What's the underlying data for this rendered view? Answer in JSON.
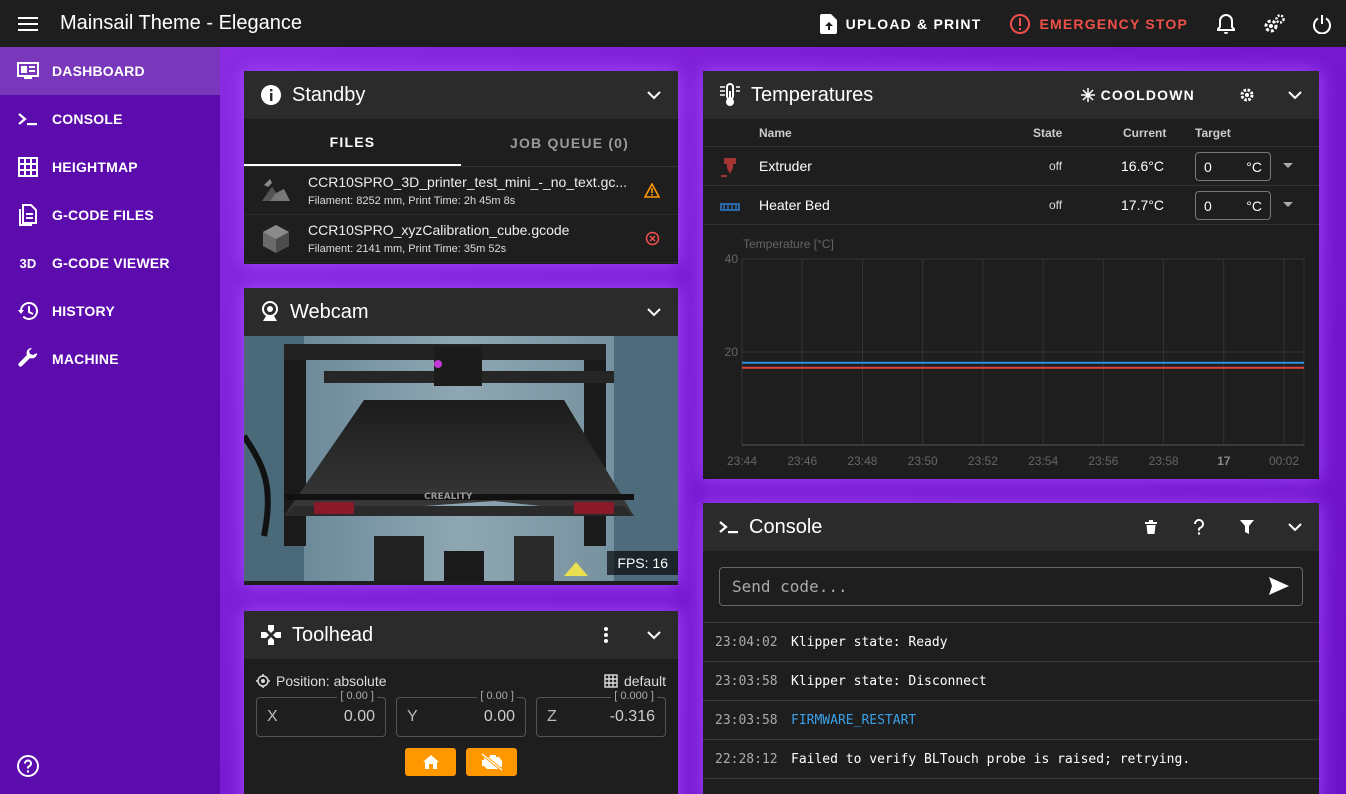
{
  "app": {
    "title": "Mainsail Theme - Elegance"
  },
  "topbar": {
    "upload_label": "UPLOAD & PRINT",
    "estop_label": "EMERGENCY STOP"
  },
  "sidebar": {
    "items": [
      {
        "label": "DASHBOARD",
        "icon": "dashboard-icon",
        "active": true
      },
      {
        "label": "CONSOLE",
        "icon": "console-icon"
      },
      {
        "label": "HEIGHTMAP",
        "icon": "grid-icon"
      },
      {
        "label": "G-CODE FILES",
        "icon": "file-icon"
      },
      {
        "label": "G-CODE VIEWER",
        "icon": "3d-icon",
        "glyph": "3D"
      },
      {
        "label": "HISTORY",
        "icon": "history-icon"
      },
      {
        "label": "MACHINE",
        "icon": "wrench-icon"
      }
    ]
  },
  "standby": {
    "title": "Standby",
    "tabs": [
      "FILES",
      "JOB QUEUE (0)"
    ],
    "files": [
      {
        "name": "CCR10SPRO_3D_printer_test_mini_-_no_text.gc...",
        "meta": "Filament: 8252 mm, Print Time: 2h 45m 8s",
        "status": "warning",
        "status_color": "#ff9800"
      },
      {
        "name": "CCR10SPRO_xyzCalibration_cube.gcode",
        "meta": "Filament: 2141 mm, Print Time: 35m 52s",
        "status": "error",
        "status_color": "#f0504a"
      }
    ]
  },
  "webcam": {
    "title": "Webcam",
    "fps": "FPS: 16",
    "brand": "CREALITY"
  },
  "toolhead": {
    "title": "Toolhead",
    "position_label": "Position: absolute",
    "mesh_label": "default",
    "axes": [
      {
        "label": "X",
        "value": "0.00",
        "target": "[ 0.00 ]"
      },
      {
        "label": "Y",
        "value": "0.00",
        "target": "[ 0.00 ]"
      },
      {
        "label": "Z",
        "value": "-0.316",
        "target": "[ 0.000 ]"
      }
    ]
  },
  "temperatures": {
    "title": "Temperatures",
    "cooldown_label": "COOLDOWN",
    "columns": {
      "name": "Name",
      "state": "State",
      "current": "Current",
      "target": "Target"
    },
    "rows": [
      {
        "name": "Extruder",
        "state": "off",
        "current": "16.6°C",
        "target": "0",
        "unit": "°C",
        "color": "#b33a3a"
      },
      {
        "name": "Heater Bed",
        "state": "off",
        "current": "17.7°C",
        "target": "0",
        "unit": "°C",
        "color": "#2a6fb3"
      }
    ]
  },
  "chart_data": {
    "type": "line",
    "ylabel": "Temperature [°C]",
    "ylim": [
      0,
      40
    ],
    "yticks": [
      "40",
      "20"
    ],
    "x": [
      "23:44",
      "23:46",
      "23:48",
      "23:50",
      "23:52",
      "23:54",
      "23:56",
      "23:58",
      "17",
      "00:02"
    ],
    "series": [
      {
        "values": [
          17.7,
          17.7,
          17.7,
          17.7,
          17.7,
          17.7,
          17.7,
          17.7,
          17.7,
          17.7
        ],
        "color": "#2f8fe0"
      },
      {
        "values": [
          16.6,
          16.6,
          16.6,
          16.6,
          16.6,
          16.6,
          16.6,
          16.6,
          16.6,
          16.6
        ],
        "color": "#e0453a"
      }
    ],
    "grid": true
  },
  "console": {
    "title": "Console",
    "placeholder": "Send code...",
    "entries": [
      {
        "time": "23:04:02",
        "message": "Klipper state: Ready",
        "type": "response"
      },
      {
        "time": "23:03:58",
        "message": "Klipper state: Disconnect",
        "type": "response"
      },
      {
        "time": "23:03:58",
        "message": "FIRMWARE_RESTART",
        "type": "command"
      },
      {
        "time": "22:28:12",
        "message": "Failed to verify BLTouch probe is raised; retrying.",
        "type": "response"
      }
    ]
  }
}
